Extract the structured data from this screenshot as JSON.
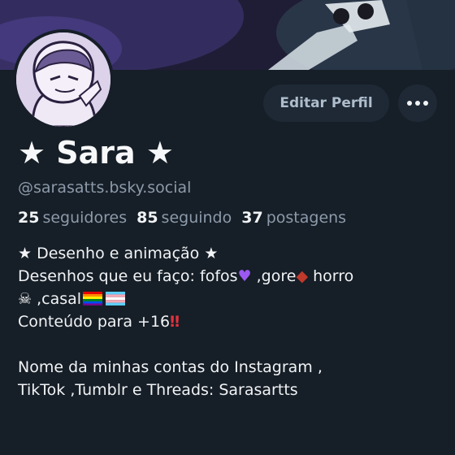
{
  "profile": {
    "display_name": "★ Sara ★",
    "handle": "@sarasatts.bsky.social",
    "edit_label": "Editar Perfil",
    "more_icon": "ellipsis-icon"
  },
  "stats": {
    "followers_count": "25",
    "followers_label": "seguidores",
    "following_count": "85",
    "following_label": "seguindo",
    "posts_count": "37",
    "posts_label": "postagens"
  },
  "bio": {
    "line1": "★ Desenho e animação ★",
    "line2_a": "Desenhos que eu faço: fofos",
    "line2_b": " ,gore",
    "line2_c": " horro",
    "line3_a": " ,casal",
    "line4": "Conteúdo para +16",
    "line6": "Nome da minhas contas do Instagram ,",
    "line7": "TikTok ,Tumblr e Threads: Sarasartts"
  },
  "colors": {
    "background": "#161e27",
    "button_bg": "#1e2935",
    "muted_text": "#8c9aaa"
  }
}
